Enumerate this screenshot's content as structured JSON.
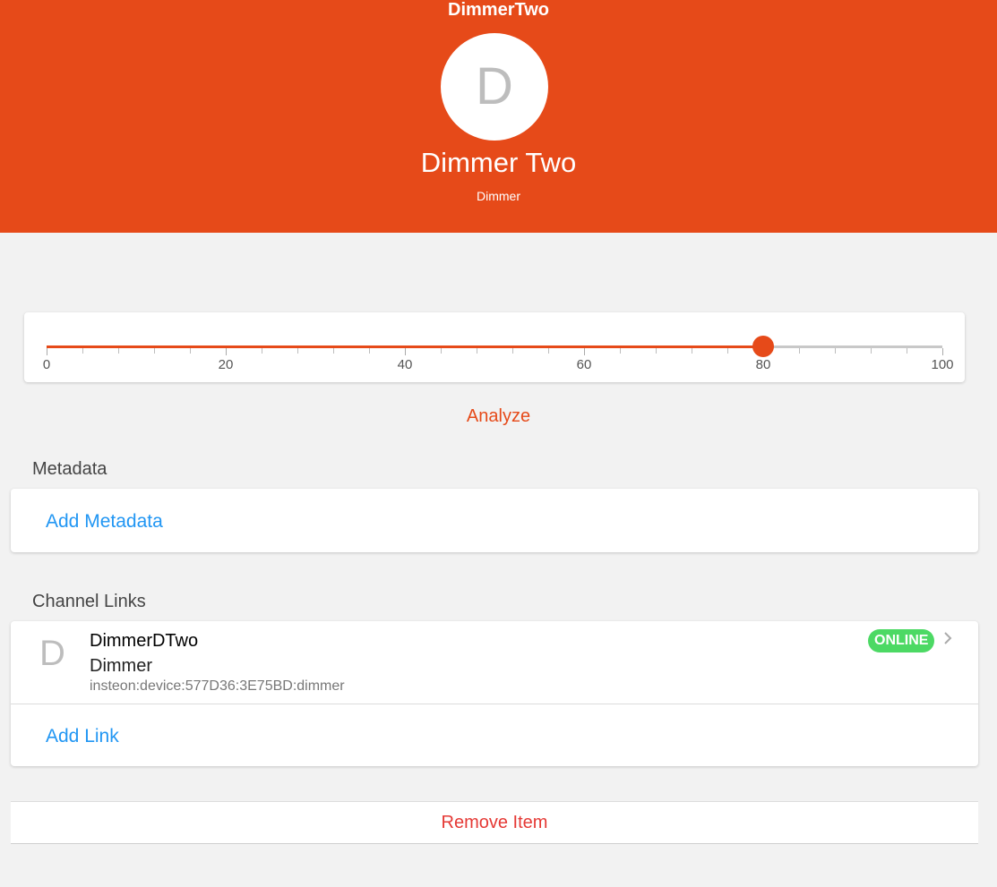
{
  "header": {
    "title": "DimmerTwo",
    "avatar_letter": "D",
    "item_label": "Dimmer Two",
    "item_type": "Dimmer",
    "background_color": "#e64a19"
  },
  "slider": {
    "value": 80,
    "min": 0,
    "max": 100,
    "tick_labels": [
      "0",
      "20",
      "40",
      "60",
      "80",
      "100"
    ],
    "accent_color": "#e64a19"
  },
  "analyze_label": "Analyze",
  "metadata": {
    "section_title": "Metadata",
    "add_label": "Add Metadata"
  },
  "channel_links": {
    "section_title": "Channel Links",
    "links": [
      {
        "letter": "D",
        "name": "DimmerDTwo",
        "type": "Dimmer",
        "uid": "insteon:device:577D36:3E75BD:dimmer",
        "status": "ONLINE",
        "status_color": "#4cd964",
        "icon": "chevron-right-icon"
      }
    ],
    "add_label": "Add Link"
  },
  "remove_label": "Remove Item"
}
